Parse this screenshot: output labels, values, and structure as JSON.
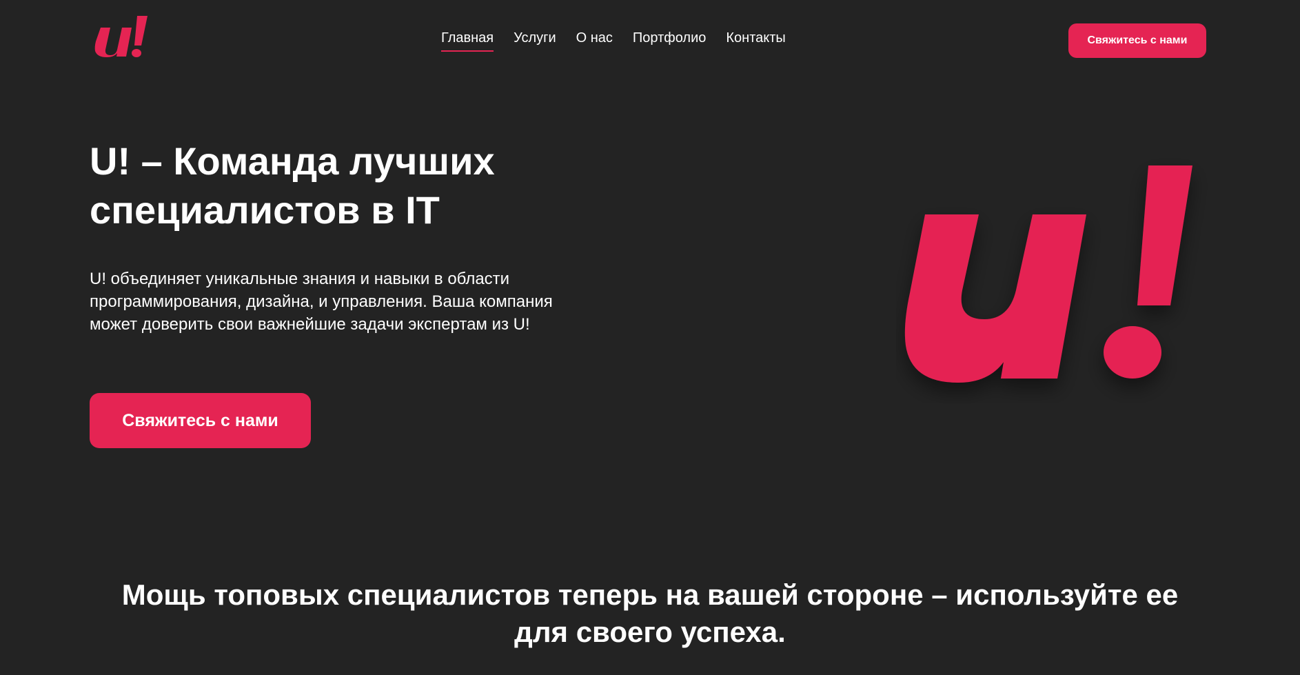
{
  "brand": {
    "logo_text": "u!",
    "accent_color": "#e52453",
    "background_color": "#232323",
    "text_color": "#ffffff"
  },
  "nav": {
    "items": [
      {
        "label": "Главная",
        "active": true
      },
      {
        "label": "Услуги",
        "active": false
      },
      {
        "label": "О нас",
        "active": false
      },
      {
        "label": "Портфолио",
        "active": false
      },
      {
        "label": "Контакты",
        "active": false
      }
    ]
  },
  "header": {
    "cta_label": "Свяжитесь с нами"
  },
  "hero": {
    "title_line1": "U! – Команда лучших",
    "title_line2": "специалистов в IT",
    "description": "U! объединяет уникальные знания и навыки в области программирования, дизайна, и управления. Ваша компания может доверить свои важнейшие задачи экспертам из U!",
    "cta_label": "Свяжитесь с нами",
    "logo_text": "u!"
  },
  "tagline": {
    "text": "Мощь топовых специалистов теперь на вашей стороне – используйте ее для своего успеха."
  }
}
